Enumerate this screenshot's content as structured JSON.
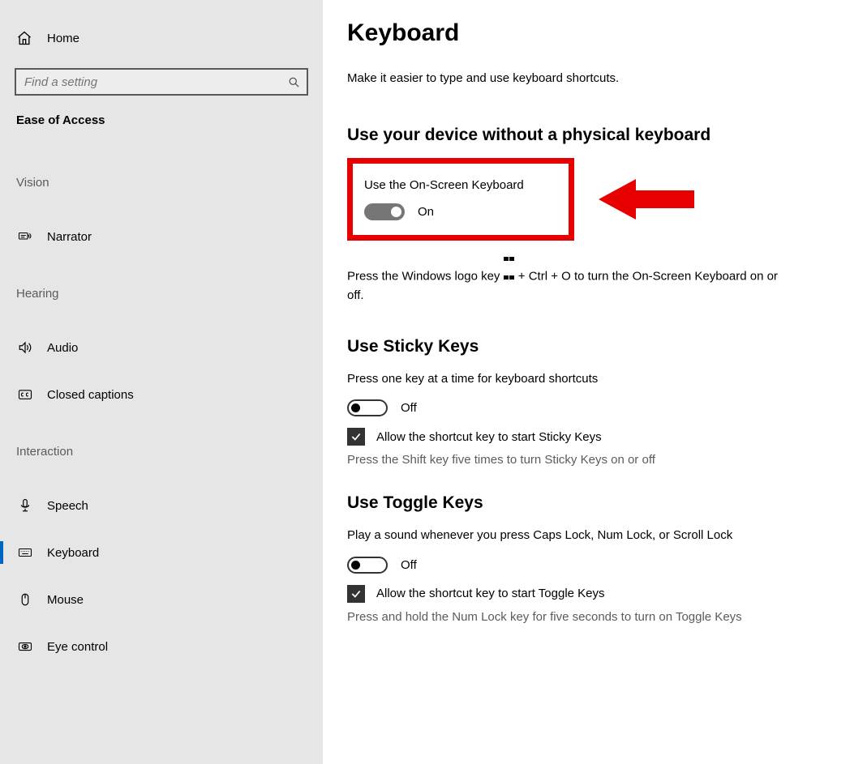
{
  "sidebar": {
    "home_label": "Home",
    "search_placeholder": "Find a setting",
    "current_page": "Ease of Access",
    "groups": [
      {
        "label": "Vision",
        "items": [
          {
            "label": "Narrator",
            "icon": "narrator"
          }
        ]
      },
      {
        "label": "Hearing",
        "items": [
          {
            "label": "Audio",
            "icon": "audio"
          },
          {
            "label": "Closed captions",
            "icon": "cc"
          }
        ]
      },
      {
        "label": "Interaction",
        "items": [
          {
            "label": "Speech",
            "icon": "speech"
          },
          {
            "label": "Keyboard",
            "icon": "keyboard",
            "selected": true
          },
          {
            "label": "Mouse",
            "icon": "mouse"
          },
          {
            "label": "Eye control",
            "icon": "eye"
          }
        ]
      }
    ]
  },
  "main": {
    "title": "Keyboard",
    "intro": "Make it easier to type and use keyboard shortcuts.",
    "s1": {
      "heading": "Use your device without a physical keyboard",
      "label": "Use the On-Screen Keyboard",
      "state": "On",
      "hint_before": "Press the Windows logo key ",
      "hint_after": " + Ctrl + O to turn the On-Screen Keyboard on or off."
    },
    "s2": {
      "heading": "Use Sticky Keys",
      "label": "Press one key at a time for keyboard shortcuts",
      "state": "Off",
      "check": "Allow the shortcut key to start Sticky Keys",
      "hint": "Press the Shift key five times to turn Sticky Keys on or off"
    },
    "s3": {
      "heading": "Use Toggle Keys",
      "label": "Play a sound whenever you press Caps Lock, Num Lock, or Scroll Lock",
      "state": "Off",
      "check": "Allow the shortcut key to start Toggle Keys",
      "hint": "Press and hold the Num Lock key for five seconds to turn on Toggle Keys"
    }
  }
}
